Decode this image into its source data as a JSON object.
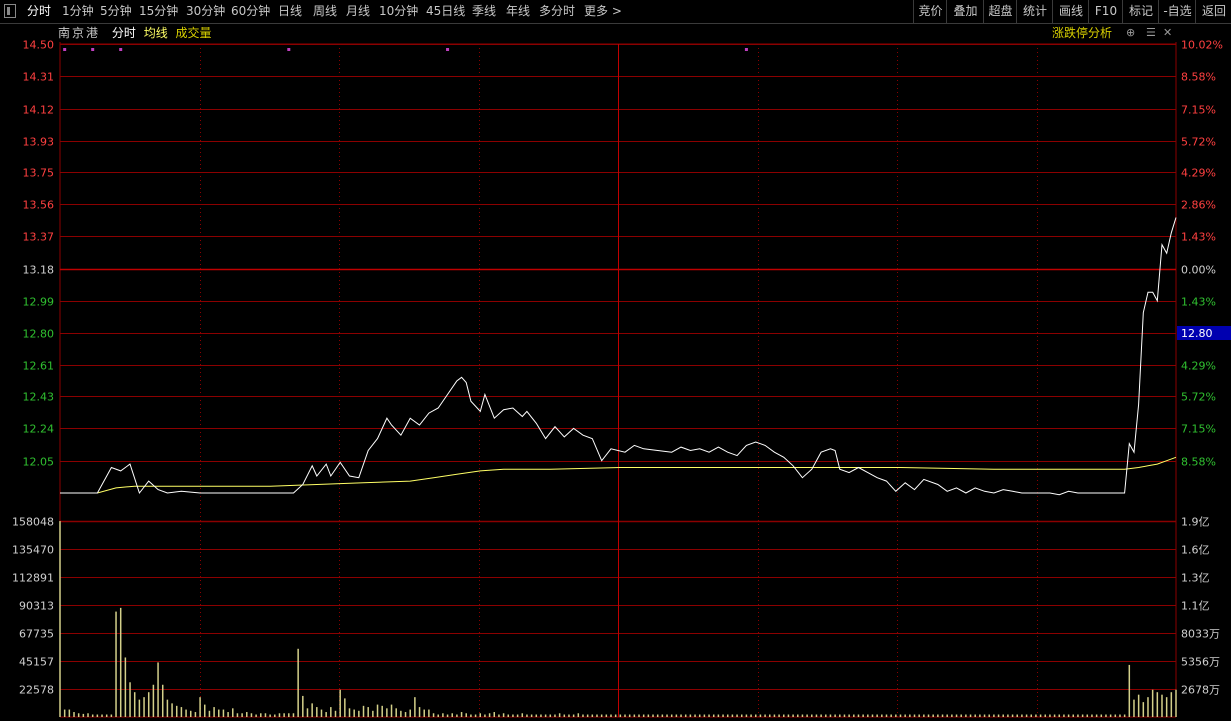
{
  "toolbar": {
    "tabs": [
      "分时",
      "1分钟",
      "5分钟",
      "15分钟",
      "30分钟",
      "60分钟",
      "日线",
      "周线",
      "月线",
      "10分钟",
      "45日线",
      "季线",
      "年线",
      "多分时",
      "更多 >"
    ],
    "right_buttons": [
      "竞价",
      "叠加",
      "超盘",
      "统计",
      "画线",
      "F10",
      "标记",
      "-自选",
      "返回"
    ]
  },
  "info": {
    "stock_name": "南京港",
    "label_timeshare": "分时",
    "label_avg": "均线",
    "label_volume": "成交量",
    "limit_analysis": "涨跌停分析"
  },
  "colors": {
    "grid": "#8b0000",
    "price_line": "#ffffff",
    "avg_line": "#ffff66",
    "volume": "#d4d08a",
    "up_text": "#ff4040",
    "down_text": "#30c030",
    "marker": "#c040c0",
    "price_tag_bg": "#0000b0"
  },
  "chart_data": {
    "type": "line",
    "price_axis": {
      "left_ticks": [
        "14.50",
        "14.31",
        "14.12",
        "13.93",
        "13.75",
        "13.56",
        "13.37",
        "13.18",
        "12.99",
        "12.80",
        "12.61",
        "12.43",
        "12.24",
        "12.05"
      ],
      "right_ticks": [
        "10.02%",
        "8.58%",
        "7.15%",
        "5.72%",
        "4.29%",
        "2.86%",
        "1.43%",
        "0.00%",
        "1.43%",
        "2.86%",
        "4.29%",
        "5.72%",
        "7.15%",
        "8.58%"
      ],
      "base_price": 13.18,
      "ylim": [
        11.86,
        14.5
      ],
      "current_price_label": "12.80"
    },
    "volume_axis": {
      "left_ticks": [
        "158048",
        "135470",
        "112891",
        "90313",
        "67735",
        "45157",
        "22578"
      ],
      "right_ticks": [
        "1.9亿",
        "1.6亿",
        "1.3亿",
        "1.1亿",
        "8033万",
        "5356万",
        "2678万"
      ],
      "ylim": [
        0,
        180626
      ]
    },
    "x_range": [
      0,
      239
    ],
    "price": [
      [
        0,
        11.86
      ],
      [
        8,
        11.86
      ],
      [
        11,
        12.01
      ],
      [
        13,
        11.99
      ],
      [
        15,
        12.03
      ],
      [
        17,
        11.86
      ],
      [
        19,
        11.93
      ],
      [
        21,
        11.88
      ],
      [
        23,
        11.86
      ],
      [
        26,
        11.87
      ],
      [
        30,
        11.86
      ],
      [
        35,
        11.86
      ],
      [
        40,
        11.86
      ],
      [
        45,
        11.86
      ],
      [
        50,
        11.86
      ],
      [
        52,
        11.91
      ],
      [
        54,
        12.02
      ],
      [
        55,
        11.96
      ],
      [
        57,
        12.03
      ],
      [
        58,
        11.96
      ],
      [
        60,
        12.04
      ],
      [
        62,
        11.96
      ],
      [
        64,
        11.95
      ],
      [
        66,
        12.11
      ],
      [
        68,
        12.18
      ],
      [
        70,
        12.3
      ],
      [
        71,
        12.26
      ],
      [
        73,
        12.2
      ],
      [
        75,
        12.3
      ],
      [
        77,
        12.26
      ],
      [
        79,
        12.33
      ],
      [
        81,
        12.36
      ],
      [
        83,
        12.44
      ],
      [
        85,
        12.52
      ],
      [
        86,
        12.54
      ],
      [
        87,
        12.51
      ],
      [
        88,
        12.4
      ],
      [
        90,
        12.34
      ],
      [
        91,
        12.44
      ],
      [
        93,
        12.3
      ],
      [
        95,
        12.35
      ],
      [
        97,
        12.36
      ],
      [
        99,
        12.31
      ],
      [
        100,
        12.34
      ],
      [
        102,
        12.27
      ],
      [
        104,
        12.18
      ],
      [
        106,
        12.25
      ],
      [
        108,
        12.19
      ],
      [
        110,
        12.24
      ],
      [
        112,
        12.2
      ],
      [
        114,
        12.18
      ],
      [
        116,
        12.05
      ],
      [
        118,
        12.12
      ],
      [
        121,
        12.1
      ],
      [
        123,
        12.14
      ],
      [
        125,
        12.12
      ],
      [
        128,
        12.11
      ],
      [
        131,
        12.1
      ],
      [
        133,
        12.13
      ],
      [
        135,
        12.11
      ],
      [
        137,
        12.12
      ],
      [
        139,
        12.1
      ],
      [
        141,
        12.13
      ],
      [
        143,
        12.1
      ],
      [
        145,
        12.08
      ],
      [
        147,
        12.14
      ],
      [
        149,
        12.16
      ],
      [
        151,
        12.14
      ],
      [
        153,
        12.1
      ],
      [
        155,
        12.07
      ],
      [
        157,
        12.02
      ],
      [
        159,
        11.95
      ],
      [
        161,
        12.0
      ],
      [
        163,
        12.1
      ],
      [
        165,
        12.12
      ],
      [
        166,
        12.11
      ],
      [
        167,
        12.0
      ],
      [
        169,
        11.98
      ],
      [
        171,
        12.01
      ],
      [
        173,
        11.98
      ],
      [
        175,
        11.95
      ],
      [
        177,
        11.93
      ],
      [
        179,
        11.87
      ],
      [
        181,
        11.92
      ],
      [
        183,
        11.88
      ],
      [
        185,
        11.94
      ],
      [
        188,
        11.91
      ],
      [
        190,
        11.87
      ],
      [
        192,
        11.89
      ],
      [
        194,
        11.86
      ],
      [
        196,
        11.89
      ],
      [
        198,
        11.87
      ],
      [
        200,
        11.86
      ],
      [
        202,
        11.88
      ],
      [
        204,
        11.87
      ],
      [
        206,
        11.86
      ],
      [
        208,
        11.86
      ],
      [
        210,
        11.86
      ],
      [
        212,
        11.86
      ],
      [
        214,
        11.85
      ],
      [
        216,
        11.87
      ],
      [
        218,
        11.86
      ],
      [
        220,
        11.86
      ],
      [
        222,
        11.86
      ],
      [
        224,
        11.86
      ],
      [
        226,
        11.86
      ],
      [
        228,
        11.86
      ],
      [
        230,
        11.86
      ],
      [
        232,
        11.86
      ],
      [
        234,
        11.86
      ],
      [
        236,
        11.86
      ],
      [
        239,
        11.86
      ]
    ],
    "price_tail": [
      [
        228,
        11.86
      ],
      [
        229,
        12.15
      ],
      [
        230,
        12.1
      ],
      [
        231,
        12.38
      ],
      [
        232,
        12.92
      ],
      [
        233,
        13.04
      ],
      [
        234,
        13.04
      ],
      [
        235,
        12.99
      ],
      [
        236,
        13.32
      ],
      [
        237,
        13.27
      ],
      [
        238,
        13.39
      ],
      [
        239,
        13.48
      ]
    ],
    "avg_price": [
      [
        0,
        11.86
      ],
      [
        8,
        11.86
      ],
      [
        12,
        11.89
      ],
      [
        16,
        11.9
      ],
      [
        20,
        11.9
      ],
      [
        30,
        11.9
      ],
      [
        45,
        11.9
      ],
      [
        55,
        11.91
      ],
      [
        65,
        11.92
      ],
      [
        75,
        11.93
      ],
      [
        80,
        11.95
      ],
      [
        85,
        11.97
      ],
      [
        90,
        11.99
      ],
      [
        95,
        12.0
      ],
      [
        105,
        12.0
      ],
      [
        120,
        12.01
      ],
      [
        140,
        12.01
      ],
      [
        160,
        12.01
      ],
      [
        180,
        12.01
      ],
      [
        200,
        12.0
      ],
      [
        220,
        12.0
      ],
      [
        228,
        12.0
      ],
      [
        231,
        12.01
      ],
      [
        233,
        12.02
      ],
      [
        235,
        12.03
      ],
      [
        237,
        12.05
      ],
      [
        239,
        12.07
      ]
    ],
    "volume": [
      [
        0,
        158000
      ],
      [
        1,
        6000
      ],
      [
        2,
        6000
      ],
      [
        3,
        4000
      ],
      [
        4,
        3000
      ],
      [
        5,
        2500
      ],
      [
        6,
        3000
      ],
      [
        7,
        2000
      ],
      [
        8,
        2000
      ],
      [
        9,
        2000
      ],
      [
        10,
        2000
      ],
      [
        11,
        2000
      ],
      [
        12,
        85000
      ],
      [
        13,
        88000
      ],
      [
        14,
        48000
      ],
      [
        15,
        28000
      ],
      [
        16,
        20000
      ],
      [
        17,
        14000
      ],
      [
        18,
        16000
      ],
      [
        19,
        20000
      ],
      [
        20,
        26000
      ],
      [
        21,
        44000
      ],
      [
        22,
        26000
      ],
      [
        23,
        14000
      ],
      [
        24,
        11000
      ],
      [
        25,
        9000
      ],
      [
        26,
        8000
      ],
      [
        27,
        6000
      ],
      [
        28,
        5000
      ],
      [
        29,
        4000
      ],
      [
        30,
        16000
      ],
      [
        31,
        10000
      ],
      [
        32,
        5000
      ],
      [
        33,
        8000
      ],
      [
        34,
        6000
      ],
      [
        35,
        6000
      ],
      [
        36,
        4000
      ],
      [
        37,
        7000
      ],
      [
        38,
        3000
      ],
      [
        39,
        3000
      ],
      [
        40,
        4000
      ],
      [
        41,
        3000
      ],
      [
        42,
        2000
      ],
      [
        43,
        3000
      ],
      [
        44,
        3000
      ],
      [
        45,
        2000
      ],
      [
        46,
        2000
      ],
      [
        47,
        3000
      ],
      [
        48,
        3000
      ],
      [
        49,
        3000
      ],
      [
        50,
        3000
      ],
      [
        51,
        55000
      ],
      [
        52,
        17000
      ],
      [
        53,
        7000
      ],
      [
        54,
        11000
      ],
      [
        55,
        8000
      ],
      [
        56,
        6000
      ],
      [
        57,
        4000
      ],
      [
        58,
        8000
      ],
      [
        59,
        5000
      ],
      [
        60,
        22000
      ],
      [
        61,
        15000
      ],
      [
        62,
        7000
      ],
      [
        63,
        6000
      ],
      [
        64,
        5000
      ],
      [
        65,
        9000
      ],
      [
        66,
        8000
      ],
      [
        67,
        5000
      ],
      [
        68,
        10000
      ],
      [
        69,
        9000
      ],
      [
        70,
        7000
      ],
      [
        71,
        10000
      ],
      [
        72,
        7000
      ],
      [
        73,
        5000
      ],
      [
        74,
        4000
      ],
      [
        75,
        6000
      ],
      [
        76,
        16000
      ],
      [
        77,
        8000
      ],
      [
        78,
        6000
      ],
      [
        79,
        6000
      ],
      [
        80,
        3000
      ],
      [
        81,
        2000
      ],
      [
        82,
        3000
      ],
      [
        83,
        2000
      ],
      [
        84,
        3000
      ],
      [
        85,
        2000
      ],
      [
        86,
        4000
      ],
      [
        87,
        3000
      ],
      [
        88,
        2000
      ],
      [
        89,
        2000
      ],
      [
        90,
        3000
      ],
      [
        91,
        2000
      ],
      [
        92,
        3000
      ],
      [
        93,
        4000
      ],
      [
        94,
        2000
      ],
      [
        95,
        3000
      ],
      [
        96,
        2000
      ],
      [
        97,
        2000
      ],
      [
        98,
        2000
      ],
      [
        99,
        3000
      ],
      [
        100,
        2000
      ],
      [
        101,
        2000
      ],
      [
        102,
        2000
      ],
      [
        103,
        2000
      ],
      [
        104,
        2000
      ],
      [
        105,
        2000
      ],
      [
        106,
        2000
      ],
      [
        107,
        3000
      ],
      [
        108,
        2000
      ],
      [
        109,
        2000
      ],
      [
        110,
        2000
      ],
      [
        111,
        3000
      ],
      [
        112,
        2000
      ],
      [
        113,
        2000
      ],
      [
        114,
        2000
      ],
      [
        115,
        2000
      ],
      [
        116,
        2000
      ],
      [
        117,
        2000
      ],
      [
        118,
        2000
      ],
      [
        119,
        2000
      ],
      [
        120,
        2000
      ],
      [
        121,
        2000
      ],
      [
        122,
        2000
      ],
      [
        123,
        2000
      ],
      [
        124,
        2000
      ],
      [
        125,
        2000
      ],
      [
        126,
        2000
      ],
      [
        127,
        2000
      ],
      [
        128,
        2000
      ],
      [
        129,
        2000
      ],
      [
        130,
        2000
      ],
      [
        131,
        2000
      ],
      [
        132,
        2000
      ],
      [
        133,
        2000
      ],
      [
        134,
        2000
      ],
      [
        135,
        2000
      ],
      [
        136,
        2000
      ],
      [
        137,
        2000
      ],
      [
        138,
        2000
      ],
      [
        139,
        2000
      ],
      [
        140,
        2000
      ],
      [
        141,
        2000
      ],
      [
        142,
        2000
      ],
      [
        143,
        2000
      ],
      [
        144,
        2000
      ],
      [
        145,
        2000
      ],
      [
        146,
        2000
      ],
      [
        147,
        2000
      ],
      [
        148,
        2000
      ],
      [
        149,
        2000
      ],
      [
        150,
        2000
      ],
      [
        151,
        2000
      ],
      [
        152,
        2000
      ],
      [
        153,
        2000
      ],
      [
        154,
        2000
      ],
      [
        155,
        2000
      ],
      [
        156,
        2000
      ],
      [
        157,
        2000
      ],
      [
        158,
        2000
      ],
      [
        159,
        2000
      ],
      [
        160,
        2000
      ],
      [
        161,
        2000
      ],
      [
        162,
        2000
      ],
      [
        163,
        2000
      ],
      [
        164,
        2000
      ],
      [
        165,
        2000
      ],
      [
        166,
        2000
      ],
      [
        167,
        2000
      ],
      [
        168,
        2000
      ],
      [
        169,
        2000
      ],
      [
        170,
        2000
      ],
      [
        171,
        2000
      ],
      [
        172,
        2000
      ],
      [
        173,
        2000
      ],
      [
        174,
        2000
      ],
      [
        175,
        2000
      ],
      [
        176,
        2000
      ],
      [
        177,
        2000
      ],
      [
        178,
        2000
      ],
      [
        179,
        2000
      ],
      [
        180,
        2000
      ],
      [
        181,
        2000
      ],
      [
        182,
        2000
      ],
      [
        183,
        2000
      ],
      [
        184,
        2000
      ],
      [
        185,
        2000
      ],
      [
        186,
        2000
      ],
      [
        187,
        2000
      ],
      [
        188,
        2000
      ],
      [
        189,
        2000
      ],
      [
        190,
        2000
      ],
      [
        191,
        2000
      ],
      [
        192,
        2000
      ],
      [
        193,
        2000
      ],
      [
        194,
        2000
      ],
      [
        195,
        2000
      ],
      [
        196,
        2000
      ],
      [
        197,
        2000
      ],
      [
        198,
        2000
      ],
      [
        199,
        2000
      ],
      [
        200,
        2000
      ],
      [
        201,
        2000
      ],
      [
        202,
        2000
      ],
      [
        203,
        2000
      ],
      [
        204,
        2000
      ],
      [
        205,
        2000
      ],
      [
        206,
        2000
      ],
      [
        207,
        2000
      ],
      [
        208,
        2000
      ],
      [
        209,
        2000
      ],
      [
        210,
        2000
      ],
      [
        211,
        2000
      ],
      [
        212,
        2000
      ],
      [
        213,
        2000
      ],
      [
        214,
        2000
      ],
      [
        215,
        2000
      ],
      [
        216,
        2000
      ],
      [
        217,
        2000
      ],
      [
        218,
        2000
      ],
      [
        219,
        2000
      ],
      [
        220,
        2000
      ],
      [
        221,
        2000
      ],
      [
        222,
        2000
      ],
      [
        223,
        2000
      ],
      [
        224,
        2000
      ],
      [
        225,
        2000
      ],
      [
        226,
        2000
      ],
      [
        227,
        2000
      ],
      [
        228,
        2000
      ],
      [
        229,
        42000
      ],
      [
        230,
        14000
      ],
      [
        231,
        18000
      ],
      [
        232,
        12000
      ],
      [
        233,
        16000
      ],
      [
        234,
        22000
      ],
      [
        235,
        20000
      ],
      [
        236,
        18000
      ],
      [
        237,
        16000
      ],
      [
        238,
        20000
      ],
      [
        239,
        22000
      ]
    ],
    "markers_x": [
      1,
      7,
      13,
      49,
      83,
      147
    ]
  }
}
